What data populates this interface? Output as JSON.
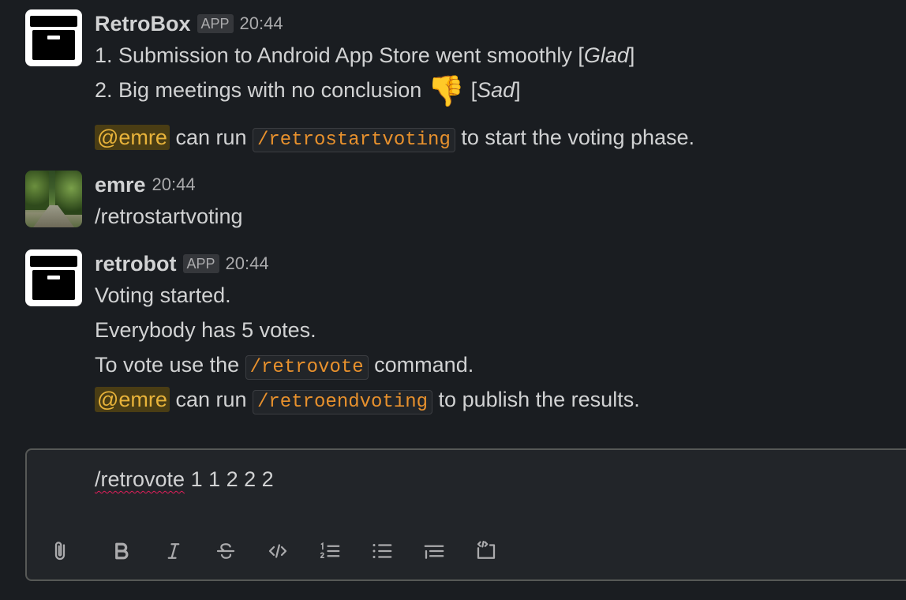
{
  "messages": [
    {
      "sender": "RetroBox",
      "badge": "APP",
      "time": "20:44",
      "lines": {
        "l1": "1. Submission to Android App Store went smoothly [",
        "l1_italic": "Glad",
        "l1_end": "]",
        "l2": "2. Big meetings with no conclusion ",
        "l2_emoji": "👎",
        "l2_after": " [",
        "l2_italic": "Sad",
        "l2_end": "]",
        "l3_mention": "@emre",
        "l3_a": " can run ",
        "l3_code": "/retrostartvoting",
        "l3_b": " to start the voting phase."
      }
    },
    {
      "sender": "emre",
      "time": "20:44",
      "text": "/retrostartvoting"
    },
    {
      "sender": "retrobot",
      "badge": "APP",
      "time": "20:44",
      "lines": {
        "l1": "Voting started.",
        "l2": "Everybody has 5 votes.",
        "l3_a": "To vote use the ",
        "l3_code": "/retrovote",
        "l3_b": " command.",
        "l4_mention": "@emre",
        "l4_a": " can run ",
        "l4_code": "/retroendvoting",
        "l4_b": " to publish the results."
      }
    }
  ],
  "composer": {
    "text_cmd": "/retrovote",
    "text_args": " 1 1 2 2 2"
  },
  "toolbar": {
    "icons": [
      "paperclip-icon",
      "bold-icon",
      "italic-icon",
      "strikethrough-icon",
      "code-icon",
      "ordered-list-icon",
      "bullet-list-icon",
      "blockquote-icon",
      "code-block-icon"
    ]
  }
}
